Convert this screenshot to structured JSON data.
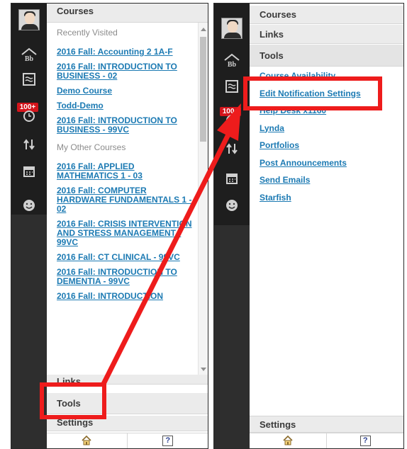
{
  "left_panel": {
    "sections": {
      "courses": "Courses",
      "links": "Links",
      "tools": "Tools",
      "settings": "Settings"
    },
    "badge": "100+",
    "recently_visited_label": "Recently Visited",
    "recently_visited": [
      "2016 Fall: Accounting 2 1A-F",
      "2016 Fall: INTRODUCTION TO BUSINESS - 02",
      "Demo Course",
      "Todd-Demo",
      "2016 Fall: INTRODUCTION TO BUSINESS - 99VC"
    ],
    "other_courses_label": "My Other Courses",
    "other_courses": [
      "2016 Fall: APPLIED MATHEMATICS 1 - 03",
      "2016 Fall: COMPUTER HARDWARE FUNDAMENTALS 1 - 02",
      "2016 Fall: CRISIS INTERVENTION AND STRESS MANAGEMENT - 99VC",
      "2016 Fall: CT CLINICAL - 99VC",
      "2016 Fall: INTRODUCTION TO DEMENTIA - 99VC",
      "2016 Fall: INTRODUCTION"
    ],
    "footer": {
      "home_icon": "home-icon",
      "help_label": "?"
    }
  },
  "right_panel": {
    "sections": {
      "courses": "Courses",
      "links": "Links",
      "tools": "Tools",
      "settings": "Settings"
    },
    "badge": "100+",
    "tools": [
      "Course Availability",
      "Edit Notification Settings",
      "Help Desk x1160",
      "Lynda",
      "Portfolios",
      "Post Announcements",
      "Send Emails",
      "Starfish"
    ],
    "footer": {
      "home_icon": "home-icon",
      "help_label": "?"
    }
  },
  "colors": {
    "link": "#1c7ab3",
    "highlight": "#ee1c1c",
    "rail": "#1e1e1e"
  }
}
